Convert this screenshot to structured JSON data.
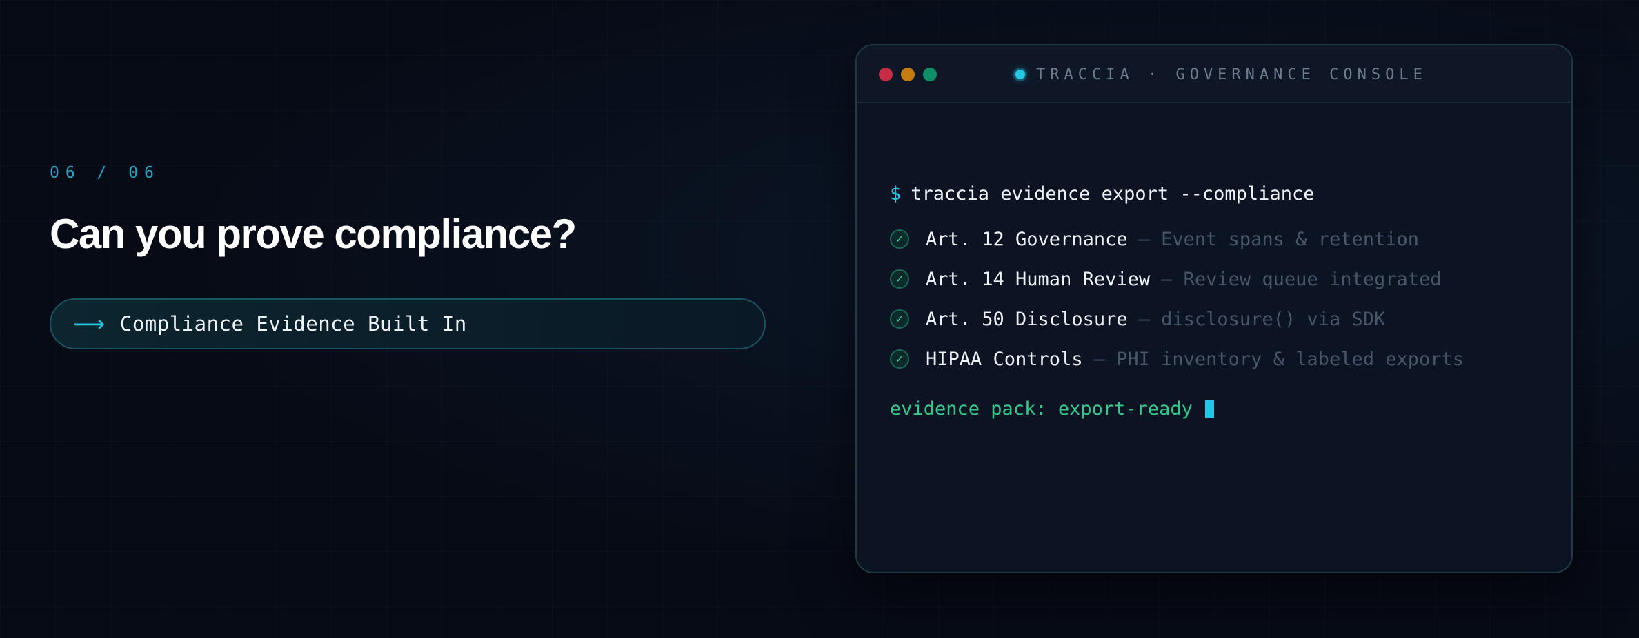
{
  "slide": {
    "counter": "06 / 06",
    "headline": "Can you prove compliance?",
    "pill": {
      "arrow": "⟶",
      "label": "Compliance Evidence Built In"
    }
  },
  "terminal": {
    "title": "TRACCIA · GOVERNANCE CONSOLE",
    "prompt": "$",
    "command": "traccia evidence export --compliance",
    "checks": [
      {
        "icon": "✓",
        "label": "Art. 12 Governance",
        "description": "— Event spans & retention"
      },
      {
        "icon": "✓",
        "label": "Art. 14 Human Review",
        "description": "— Review queue integrated"
      },
      {
        "icon": "✓",
        "label": "Art. 50 Disclosure",
        "description": "— disclosure() via SDK"
      },
      {
        "icon": "✓",
        "label": "HIPAA Controls",
        "description": "— PHI inventory & labeled exports"
      }
    ],
    "status": "evidence pack: export-ready"
  },
  "colors": {
    "background": "#070b16",
    "accent": "#26c6e4",
    "success": "#32c98a",
    "window_red": "#c42d45",
    "window_yellow": "#c57c10",
    "window_green": "#0f8f68"
  }
}
